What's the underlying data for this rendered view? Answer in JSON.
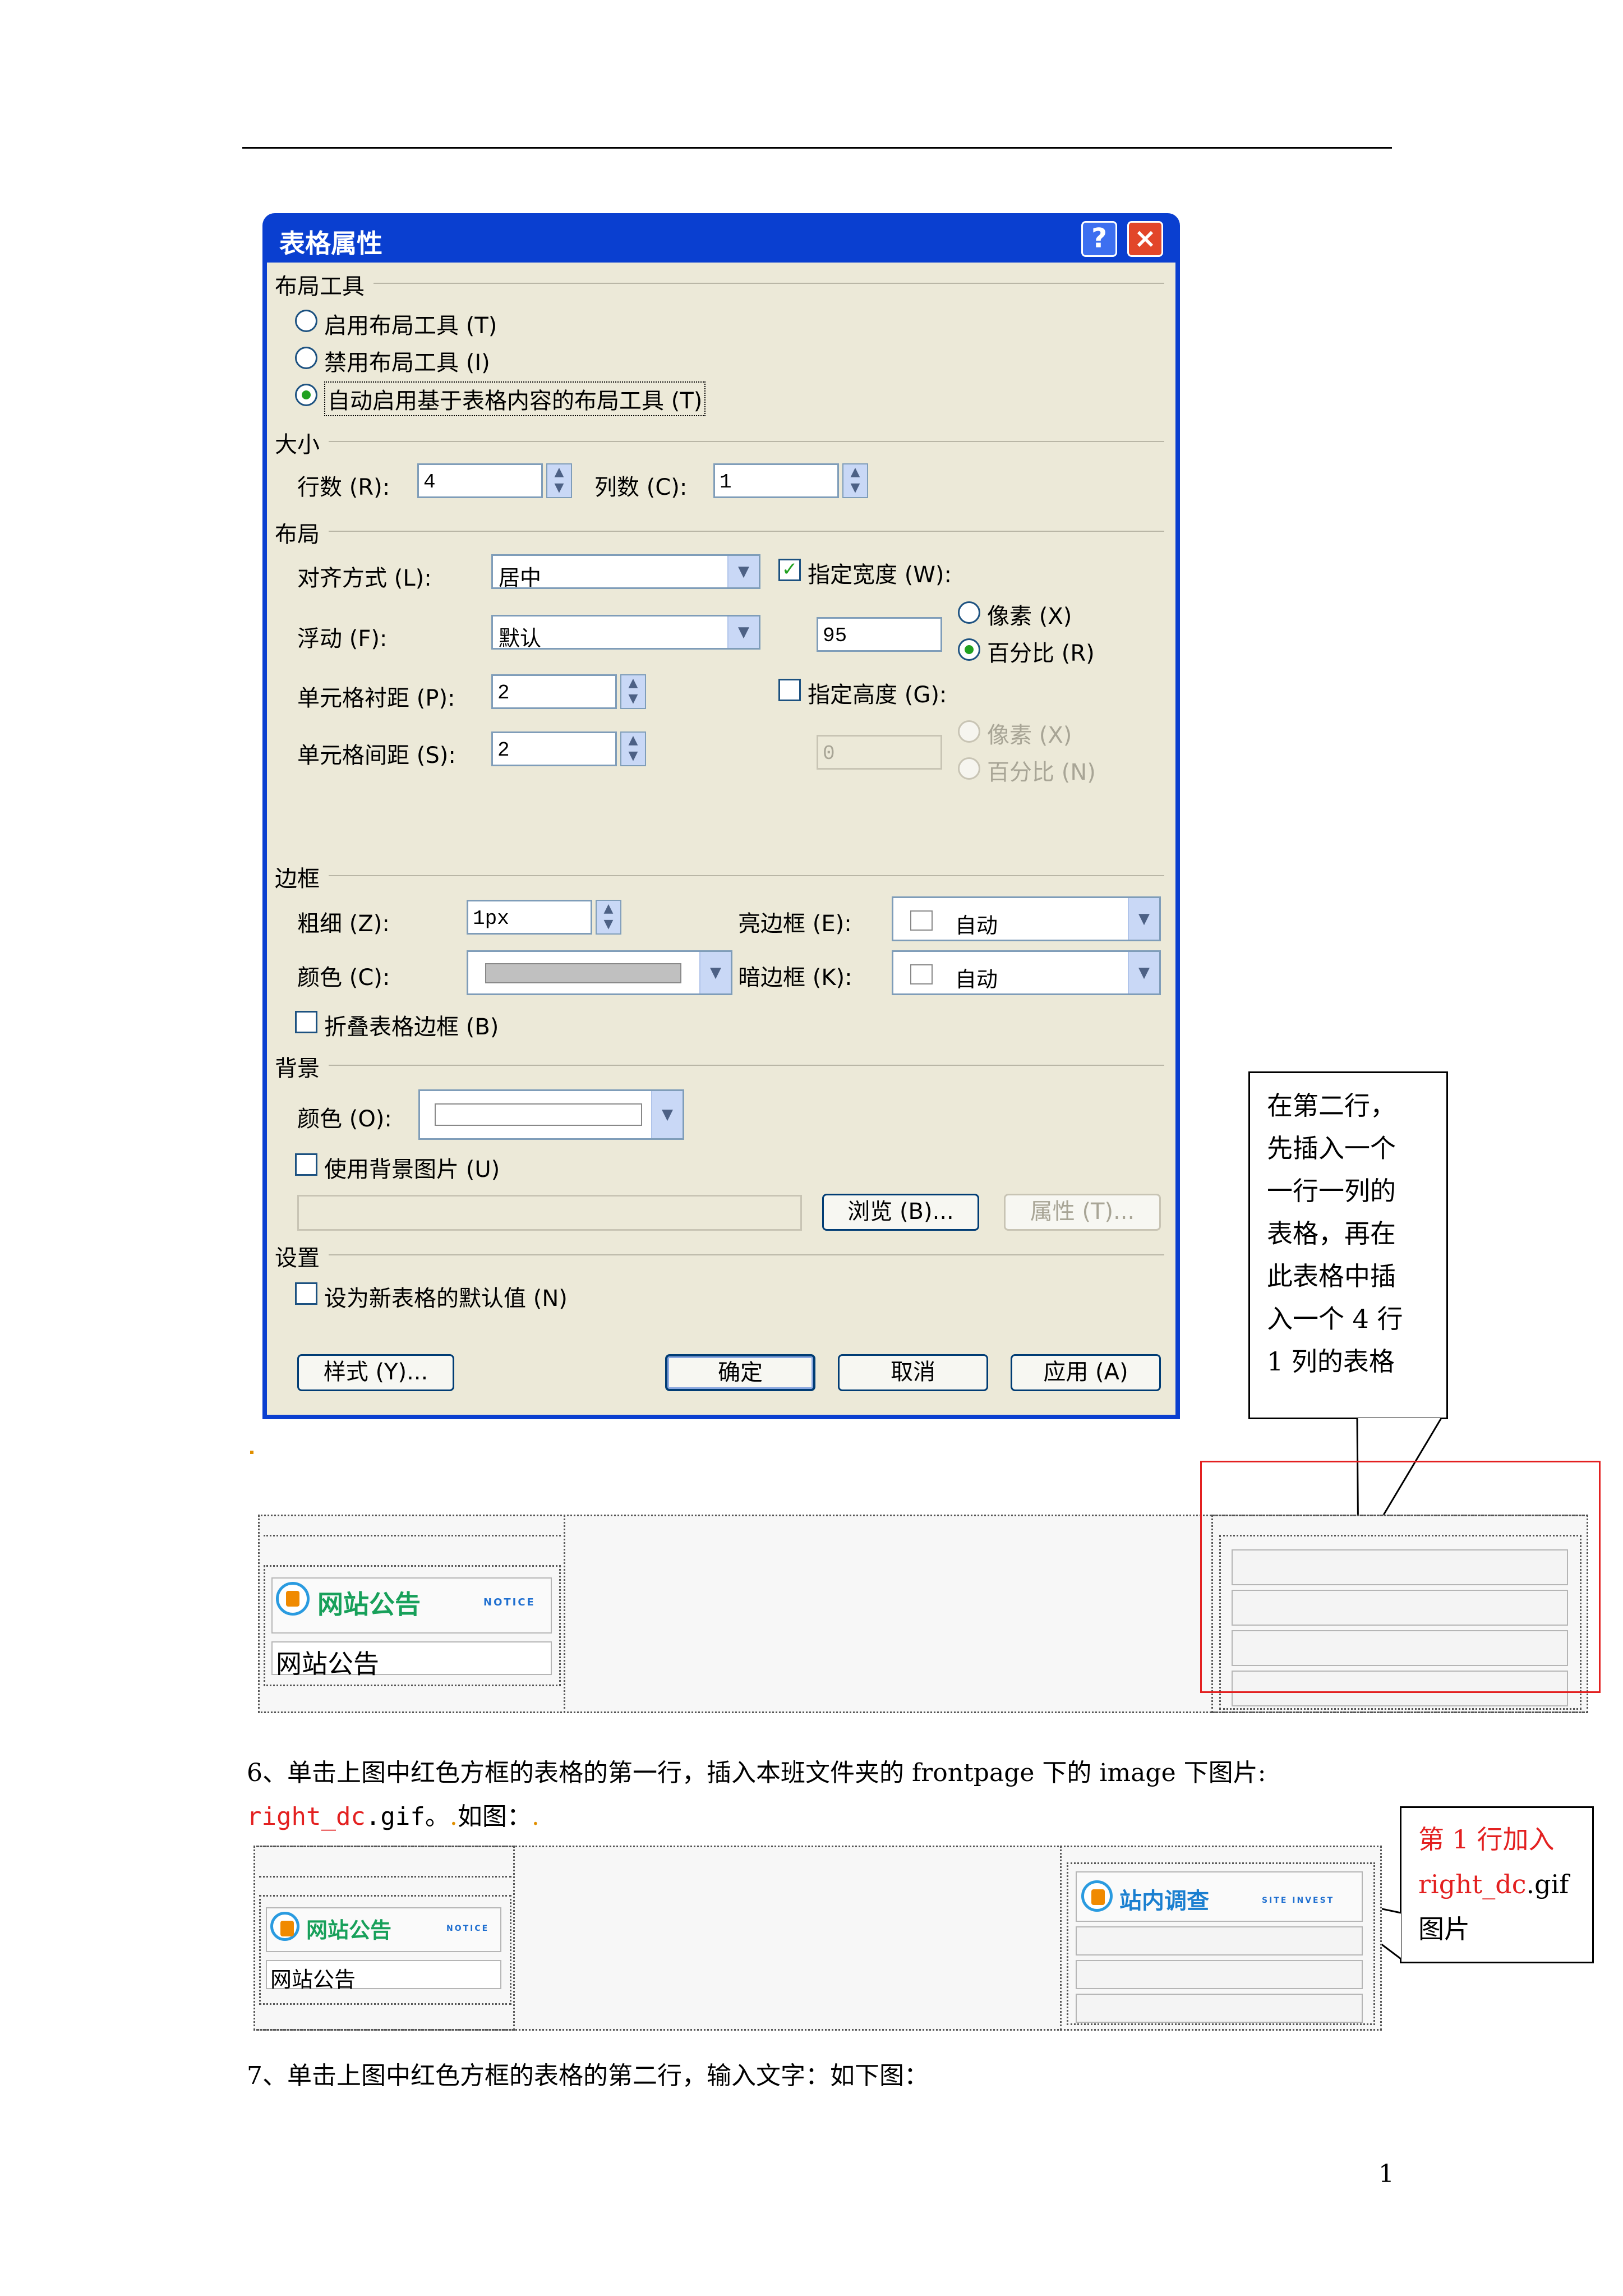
{
  "dialog": {
    "title": "表格属性",
    "help_label": "?",
    "close_label": "×",
    "layout_tools": {
      "heading": "布局工具",
      "options": [
        "启用布局工具 (T)",
        "禁用布局工具 (I)",
        "自动启用基于表格内容的布局工具 (T)"
      ],
      "selected_index": 2
    },
    "size": {
      "heading": "大小",
      "rows_label": "行数 (R):",
      "rows_value": "4",
      "cols_label": "列数 (C):",
      "cols_value": "1"
    },
    "layout": {
      "heading": "布局",
      "align_label": "对齐方式 (L):",
      "align_value": "居中",
      "float_label": "浮动 (F):",
      "float_value": "默认",
      "padding_label": "单元格衬距 (P):",
      "padding_value": "2",
      "spacing_label": "单元格间距 (S):",
      "spacing_value": "2",
      "width_check_label": "指定宽度 (W):",
      "width_checked": true,
      "width_value": "95",
      "width_unit_px": "像素 (X)",
      "width_unit_pct": "百分比 (R)",
      "height_check_label": "指定高度 (G):",
      "height_checked": false,
      "height_value": "0",
      "height_unit_px": "像素 (X)",
      "height_unit_pct": "百分比 (N)"
    },
    "border": {
      "heading": "边框",
      "size_label": "粗细 (Z):",
      "size_value": "1px",
      "color_label": "颜色 (C):",
      "light_label": "亮边框 (E):",
      "light_value": "自动",
      "dark_label": "暗边框 (K):",
      "dark_value": "自动",
      "collapse_label": "折叠表格边框 (B)"
    },
    "background": {
      "heading": "背景",
      "color_label": "颜色 (O):",
      "use_image_label": "使用背景图片 (U)",
      "browse_label": "浏览 (B)...",
      "props_label": "属性 (T)..."
    },
    "settings": {
      "heading": "设置",
      "default_label": "设为新表格的默认值 (N)"
    },
    "buttons": {
      "style": "样式 (Y)...",
      "ok": "确定",
      "cancel": "取消",
      "apply": "应用 (A)"
    }
  },
  "callout1": {
    "lines": [
      "在第二行，",
      "先插入一个",
      "一行一列的",
      "表格，再在",
      "此表格中插",
      "入一个 4 行",
      "1 列的表格"
    ]
  },
  "preview1": {
    "banner_text": "网站公告",
    "banner_small": "NOTICE",
    "cell_text": "网站公告"
  },
  "step6": {
    "line1": "6、单击上图中红色方框的表格的第一行，插入本班文件夹的 frontpage 下的 image 下图片:",
    "filename_red": "right_dc",
    "filename_rest": ".gif。",
    "after": "如图：",
    "trail": "."
  },
  "callout2": {
    "line1": "第 1 行加入",
    "line2_red": "right_dc",
    "line2_rest": ".gif",
    "line3": "图片"
  },
  "preview2": {
    "banner_text": "网站公告",
    "banner_small": "NOTICE",
    "cell_text": "网站公告",
    "survey_text": "站内调查",
    "survey_small": "SITE INVEST"
  },
  "step7": "7、单击上图中红色方框的表格的第二行，输入文字：如下图：",
  "page_number": "1",
  "colors": {
    "red": "#e32020",
    "dialog_blue": "#0a3fd0",
    "dialog_face": "#ece9d8"
  }
}
